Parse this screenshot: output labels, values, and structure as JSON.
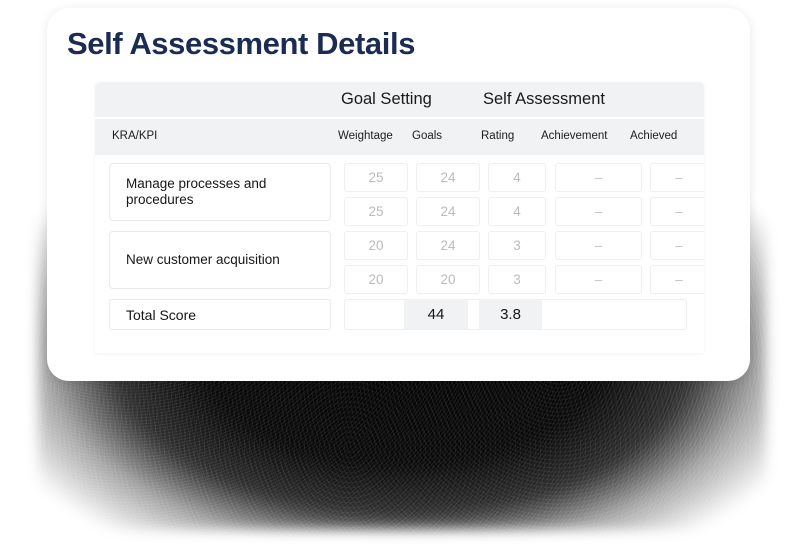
{
  "page_title": "Self Assessment Details",
  "colors": {
    "title": "#1b2c54",
    "header_bg": "#f1f2f3",
    "card_bg": "#ffffff",
    "cell_border": "#eeeff0",
    "muted_value": "#b9bbbf"
  },
  "table": {
    "group_headers": {
      "goal_setting": "Goal Setting",
      "self_assessment": "Self Assessment"
    },
    "columns": {
      "kra": "KRA/KPI",
      "weightage": "Weightage",
      "goals": "Goals",
      "rating": "Rating",
      "achievement": "Achievement",
      "achieved": "Achieved"
    },
    "rows": [
      {
        "kra": "Manage processes and procedures",
        "lines": [
          {
            "weightage": "25",
            "goals": "24",
            "rating": "4",
            "achievement": "–",
            "achieved": "–"
          },
          {
            "weightage": "25",
            "goals": "24",
            "rating": "4",
            "achievement": "–",
            "achieved": "–"
          }
        ]
      },
      {
        "kra": "New customer acquisition",
        "lines": [
          {
            "weightage": "20",
            "goals": "24",
            "rating": "3",
            "achievement": "–",
            "achieved": "–"
          },
          {
            "weightage": "20",
            "goals": "20",
            "rating": "3",
            "achievement": "–",
            "achieved": "–"
          }
        ]
      }
    ],
    "total": {
      "label": "Total Score",
      "goals": "44",
      "rating": "3.8"
    }
  }
}
